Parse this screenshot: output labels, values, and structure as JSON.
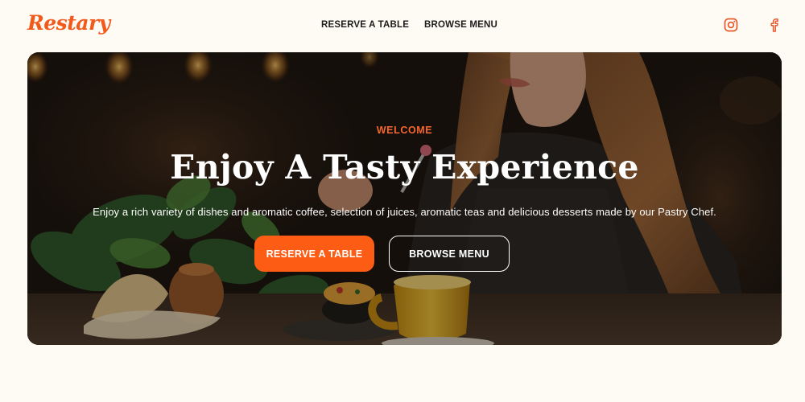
{
  "brand": {
    "logo": "Restary",
    "accent_color": "#fc5c14"
  },
  "nav": {
    "links": [
      {
        "label": "RESERVE A TABLE"
      },
      {
        "label": "BROWSE MENU"
      }
    ],
    "social": [
      {
        "icon": "instagram-icon"
      },
      {
        "icon": "facebook-icon"
      }
    ]
  },
  "hero": {
    "eyebrow": "WELCOME",
    "title": "Enjoy A Tasty Experience",
    "subtitle": "Enjoy a rich variety of dishes and aromatic coffee, selection of juices, aromatic teas and delicious desserts made by our Pastry Chef.",
    "primary_cta": "RESERVE A TABLE",
    "secondary_cta": "BROWSE MENU"
  }
}
